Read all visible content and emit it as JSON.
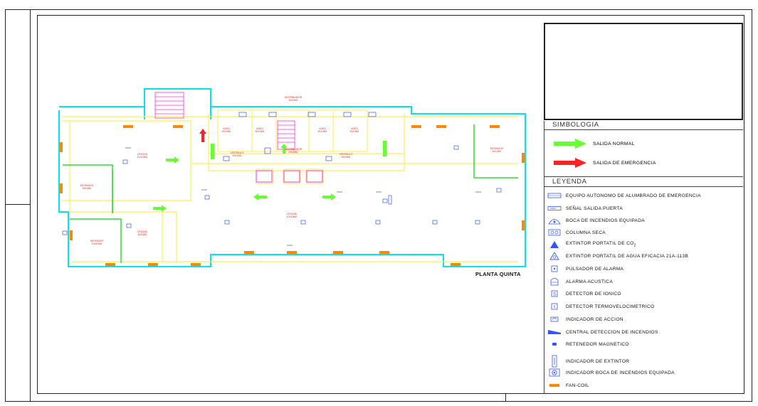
{
  "plan": {
    "title": "PLANTA QUINTA",
    "rooms": [
      {
        "label": "OFICINA\n10X10M2"
      },
      {
        "label": "DESPACHO\n5X10M2"
      },
      {
        "label": "DESPACHO\n10X10M2"
      },
      {
        "label": "OFICINA\n5X10M2"
      },
      {
        "label": "OFICINA\n10X10M2"
      },
      {
        "label": "DESPACHO\n5X10M2"
      },
      {
        "label": "ASEO\n5X10M2"
      },
      {
        "label": "ASEO\n5X10M2"
      },
      {
        "label": "ASEO\n5X10M2"
      },
      {
        "label": "ASEO\n5X10M2"
      },
      {
        "label": "VESTIBULO\n5X10M2"
      },
      {
        "label": "VESTIBULO\n5X10M2"
      },
      {
        "label": "DISTRIBUIDOR\n5X10M2"
      },
      {
        "label": "DISTRIBUIDOR\n5X10M2"
      }
    ]
  },
  "simbologia": {
    "title": "SIMBOLOGIA",
    "items": [
      {
        "label": "SALIDA NORMAL",
        "color": "#66ff33",
        "icon": "green-arrow-icon"
      },
      {
        "label": "SALIDA DE EMERGENCIA",
        "color": "#ff2222",
        "icon": "red-arrow-icon"
      }
    ]
  },
  "leyenda": {
    "title": "LEYENDA",
    "items": [
      {
        "label": "EQUIPO AUTONOMO DE ALUMBRADO DE EMERGENCIA",
        "icon": "emergency-light-icon"
      },
      {
        "label": "SEÑAL SALIDA PUERTA",
        "icon": "exit-sign-icon"
      },
      {
        "label": "BOCA DE INCENDIOS EQUIPADA",
        "icon": "fire-hose-icon"
      },
      {
        "label": "COLUMNA SECA",
        "icon": "dry-riser-icon"
      },
      {
        "label": "EXTINTOR PORTATIL DE CO",
        "sub": "2",
        "icon": "co2-extinguisher-icon"
      },
      {
        "label": "EXTINTOR PORTATIL DE AGUA EFICACIA 21A-113B",
        "icon": "water-extinguisher-icon"
      },
      {
        "label": "PULSADOR DE ALARMA",
        "icon": "alarm-button-icon"
      },
      {
        "label": "ALARMA ACUSTICA",
        "icon": "acoustic-alarm-icon"
      },
      {
        "label": "DETECTOR DE IONICO",
        "icon": "ionic-detector-icon"
      },
      {
        "label": "DETECTOR TERMOVELOCIMETRICO",
        "icon": "thermo-detector-icon"
      },
      {
        "label": "INDICADOR DE ACCION",
        "icon": "action-indicator-icon"
      },
      {
        "label": "CENTRAL DETECCION DE INCENDIOS",
        "icon": "fire-panel-icon"
      },
      {
        "label": "RETENEDOR MAGNETICO",
        "icon": "magnetic-holder-icon"
      },
      {
        "label": "INDICADOR DE EXTINTOR",
        "icon": "extinguisher-indicator-icon"
      },
      {
        "label": "INDICADOR BOCA DE INCENDIOS EQUIPADA",
        "icon": "hose-indicator-icon"
      },
      {
        "label": "FAN-COIL",
        "icon": "fan-coil-icon"
      }
    ]
  },
  "colors": {
    "wall": "#00e5ee",
    "inner": "#ffee55",
    "partition": "#33dd33",
    "symbol": "#3355ff",
    "text_red": "#ee2222",
    "fan_coil": "#ff8800",
    "stairs": "#ff33cc"
  }
}
